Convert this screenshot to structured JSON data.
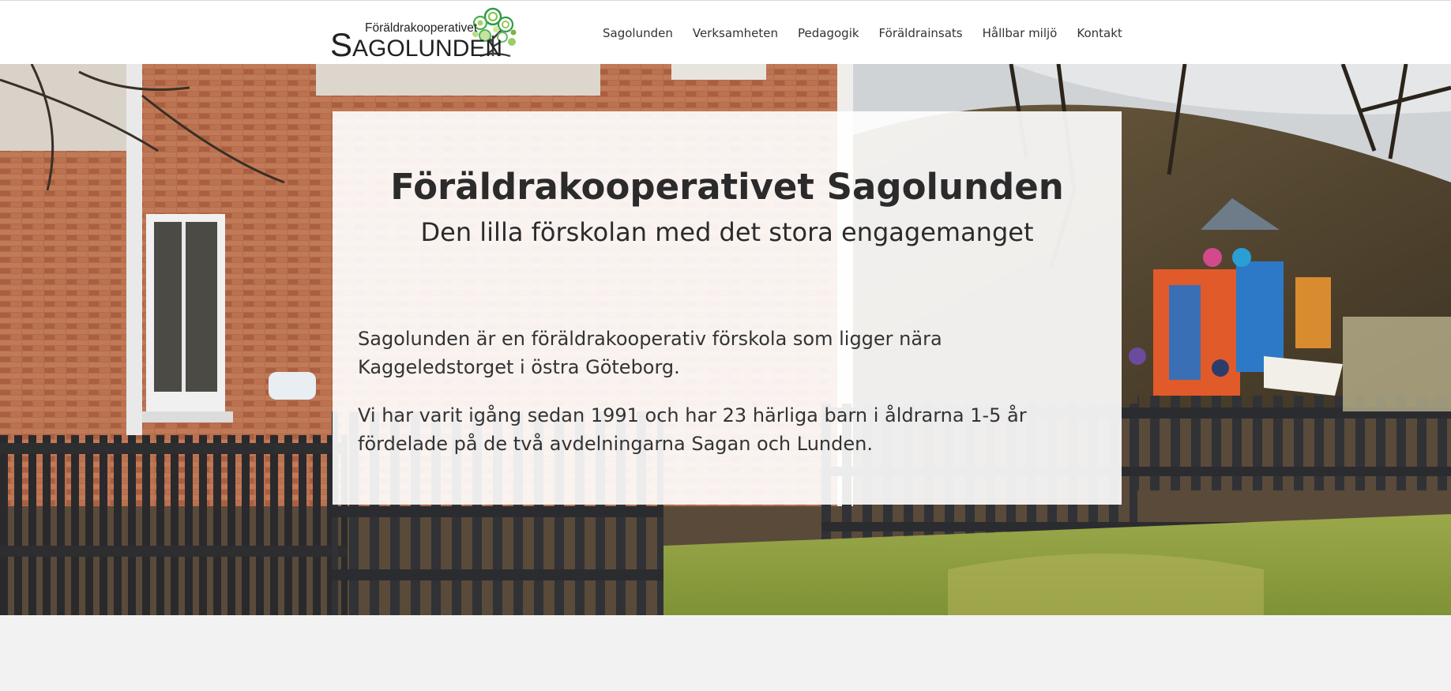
{
  "logo": {
    "small_text": "Föräldrakooperativet",
    "big_initial": "S",
    "big_rest": "AGOLUNDEN"
  },
  "nav": {
    "items": [
      "Sagolunden",
      "Verksamheten",
      "Pedagogik",
      "Föräldrainsats",
      "Hållbar miljö",
      "Kontakt"
    ]
  },
  "hero": {
    "title": "Föräldrakooperativet Sagolunden",
    "subtitle": "Den lilla förskolan med det stora engagemanget",
    "paragraphs": [
      "Sagolunden är en föräldrakooperativ förskola som ligger nära Kaggeledstorget i östra Göteborg.",
      "Vi har varit igång sedan 1991 och har 23 härliga barn i åldrarna 1-5 år fördelade på de två avdelningarna Sagan och Lunden."
    ]
  },
  "colors": {
    "header_bg": "#ffffff",
    "text": "#333333",
    "logo_green": "#4caf50",
    "page_bg": "#f2f2f2"
  }
}
